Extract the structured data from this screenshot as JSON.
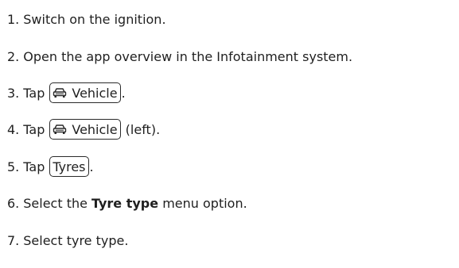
{
  "steps": [
    {
      "num": "1.",
      "text": "Switch on the ignition."
    },
    {
      "num": "2.",
      "text": "Open the app overview in the Infotainment system."
    },
    {
      "num": "3.",
      "pre": "Tap",
      "key": "Vehicle",
      "post": "."
    },
    {
      "num": "4.",
      "pre": "Tap",
      "key": "Vehicle",
      "post": " (left)."
    },
    {
      "num": "5.",
      "pre": "Tap",
      "key": "Tyres",
      "post": "."
    },
    {
      "num": "6.",
      "pre": "Select the",
      "bold": "Tyre type",
      "post": " menu option."
    },
    {
      "num": "7.",
      "text": "Select tyre type."
    }
  ],
  "icons": {
    "vehicle": "car-icon"
  }
}
